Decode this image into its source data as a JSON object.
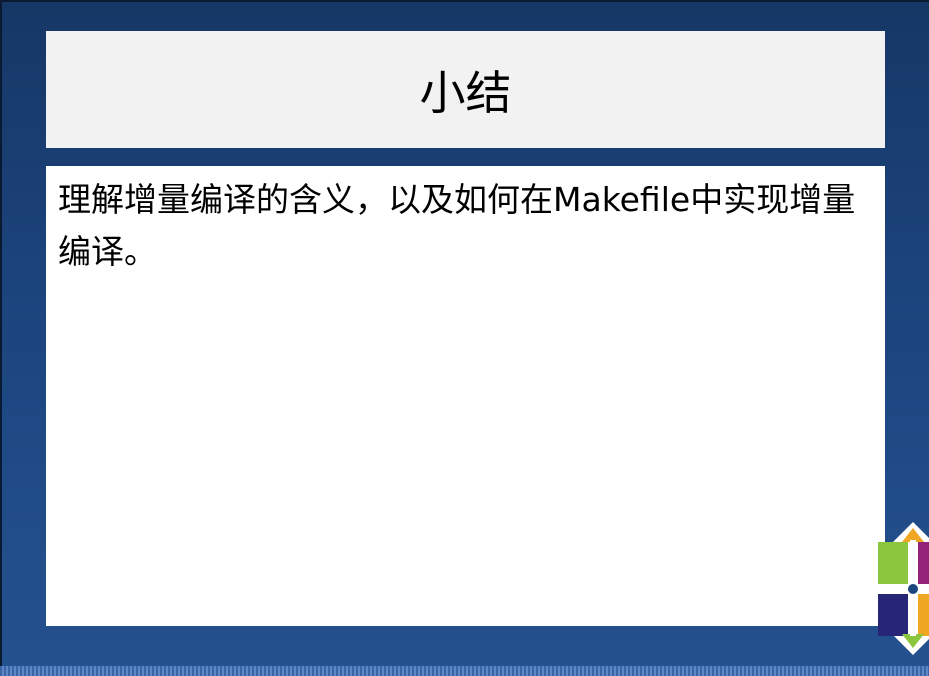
{
  "slide": {
    "title": "小结",
    "body": "理解增量编译的含义，以及如何在Makefile中实现增量编译。"
  }
}
